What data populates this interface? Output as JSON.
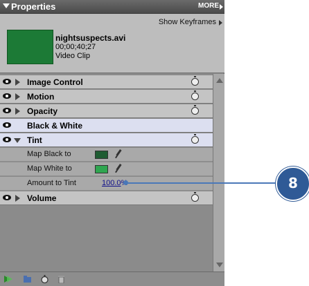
{
  "panel": {
    "title": "Properties",
    "more": "MORE",
    "show_keyframes": "Show Keyframes"
  },
  "clip": {
    "name": "nightsuspects.avi",
    "timecode": "00;00;40;27",
    "type": "Video Clip"
  },
  "effects": {
    "image_control": "Image Control",
    "motion": "Motion",
    "opacity": "Opacity",
    "black_white": "Black & White",
    "tint": "Tint",
    "volume": "Volume"
  },
  "tint": {
    "map_black_label": "Map Black to",
    "map_black_color": "#1f5c32",
    "map_white_label": "Map White to",
    "map_white_color": "#2fa650",
    "amount_label": "Amount to Tint",
    "amount_value": "100.0",
    "amount_unit": "%"
  },
  "callout": {
    "number": "8"
  },
  "colors": {
    "callout": "#2f5a96",
    "link_value": "#10108a",
    "thumbnail": "#1c7a36"
  }
}
